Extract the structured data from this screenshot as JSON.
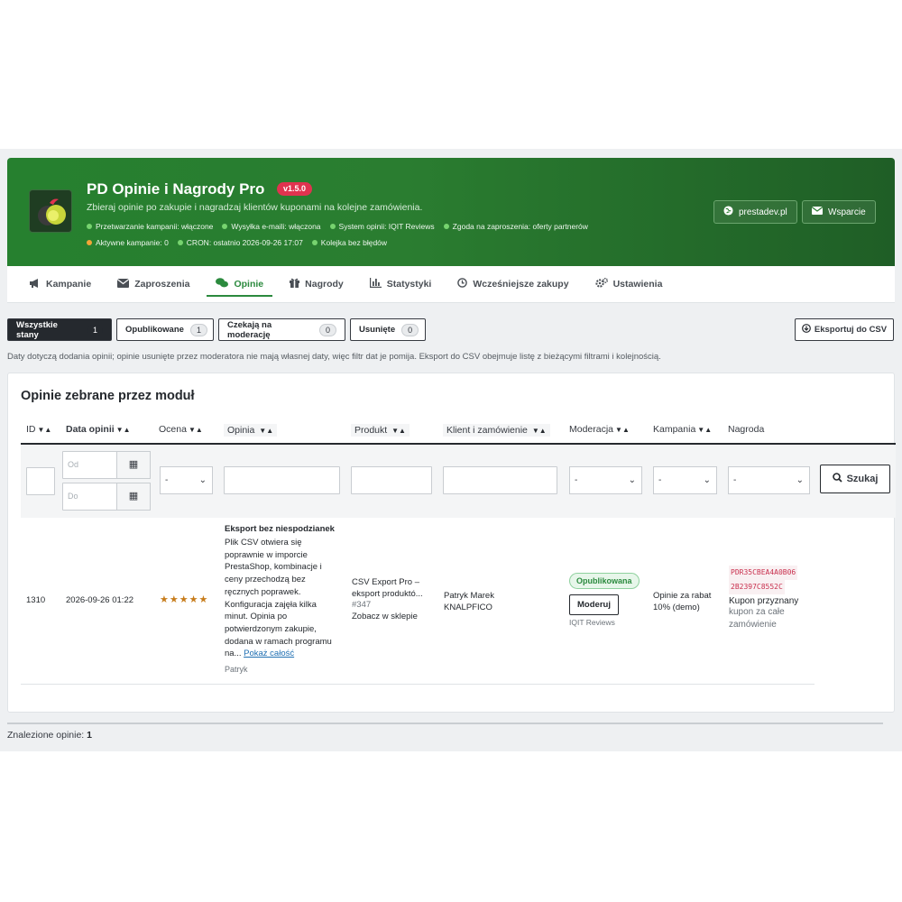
{
  "header": {
    "title": "PD Opinie i Nagrody Pro",
    "version": "v1.5.0",
    "subtitle": "Zbieraj opinie po zakupie i nagradzaj klientów kuponami na kolejne zamówienia.",
    "status_row1": [
      {
        "text": "Przetwarzanie kampanii: włączone",
        "color": "#77d36f"
      },
      {
        "text": "Wysyłka e-maili: włączona",
        "color": "#77d36f"
      },
      {
        "text": "System opinii: IQIT Reviews",
        "color": "#77d36f"
      },
      {
        "text": "Zgoda na zaproszenia: oferty partnerów",
        "color": "#77d36f"
      }
    ],
    "status_row2": [
      {
        "text": "Aktywne kampanie: 0",
        "color": "#f3a537"
      },
      {
        "text": "CRON: ostatnio 2026-09-26 17:07",
        "color": "#77d36f"
      },
      {
        "text": "Kolejka bez błędów",
        "color": "#77d36f"
      }
    ],
    "link_site": "prestadev.pl",
    "link_support": "Wsparcie"
  },
  "tabs": [
    {
      "label": "Kampanie",
      "icon": "megaphone-icon",
      "active": false
    },
    {
      "label": "Zaproszenia",
      "icon": "envelope-icon",
      "active": false
    },
    {
      "label": "Opinie",
      "icon": "comments-icon",
      "active": true
    },
    {
      "label": "Nagrody",
      "icon": "gift-icon",
      "active": false
    },
    {
      "label": "Statystyki",
      "icon": "bar-chart-icon",
      "active": false
    },
    {
      "label": "Wcześniejsze zakupy",
      "icon": "history-icon",
      "active": false
    },
    {
      "label": "Ustawienia",
      "icon": "cogs-icon",
      "active": false
    }
  ],
  "filters": {
    "all": {
      "label": "Wszystkie stany",
      "count": "1"
    },
    "published": {
      "label": "Opublikowane",
      "count": "1"
    },
    "pending": {
      "label": "Czekają na moderację",
      "count": "0"
    },
    "deleted": {
      "label": "Usunięte",
      "count": "0"
    },
    "export": "Eksportuj do CSV"
  },
  "note": "Daty dotyczą dodania opinii; opinie usunięte przez moderatora nie mają własnej daty, więc filtr dat je pomija. Eksport do CSV obejmuje listę z bieżącymi filtrami i kolejnością.",
  "panel": {
    "title": "Opinie zebrane przez moduł",
    "columns": {
      "id": "ID",
      "date": "Data opinii",
      "rating": "Ocena",
      "review": "Opinia",
      "product": "Produkt",
      "customer": "Klient i zamówienie",
      "moderation": "Moderacja",
      "campaign": "Kampania",
      "reward": "Nagroda"
    },
    "filter_inputs": {
      "date_from_placeholder": "Od",
      "date_to_placeholder": "Do",
      "select_default": "-",
      "search_label": "Szukaj"
    },
    "rows": [
      {
        "id": "1310",
        "date": "2026-09-26 01:22",
        "rating": "★★★★★",
        "review_title": "Eksport bez niespodzianek",
        "review_body": "Plik CSV otwiera się poprawnie w imporcie PrestaShop, kombinacje i ceny przechodzą bez ręcznych poprawek. Konfiguracja zajęła kilka minut. Opinia po potwierdzonym zakupie, dodana w ramach programu na...",
        "review_more": "Pokaż całość",
        "review_author": "Patryk",
        "product_name": "CSV Export Pro – eksport produktó...",
        "product_id": "#347",
        "product_link": "Zobacz w sklepie",
        "customer_name": "Patryk Marek",
        "customer_order": "KNALPFICO",
        "moderation_status": "Opublikowana",
        "moderate_button": "Moderuj",
        "moderation_source": "IQIT Reviews",
        "campaign": "Opinie za rabat 10% (demo)",
        "coupon_line1": "PDR35CBEA4A0B06",
        "coupon_line2": "2B2397C8552C",
        "reward_status": "Kupon przyznany",
        "reward_desc": "kupon za całe zamówienie"
      }
    ]
  },
  "footer": {
    "found_label": "Znalezione opinie:",
    "found_count": "1"
  }
}
